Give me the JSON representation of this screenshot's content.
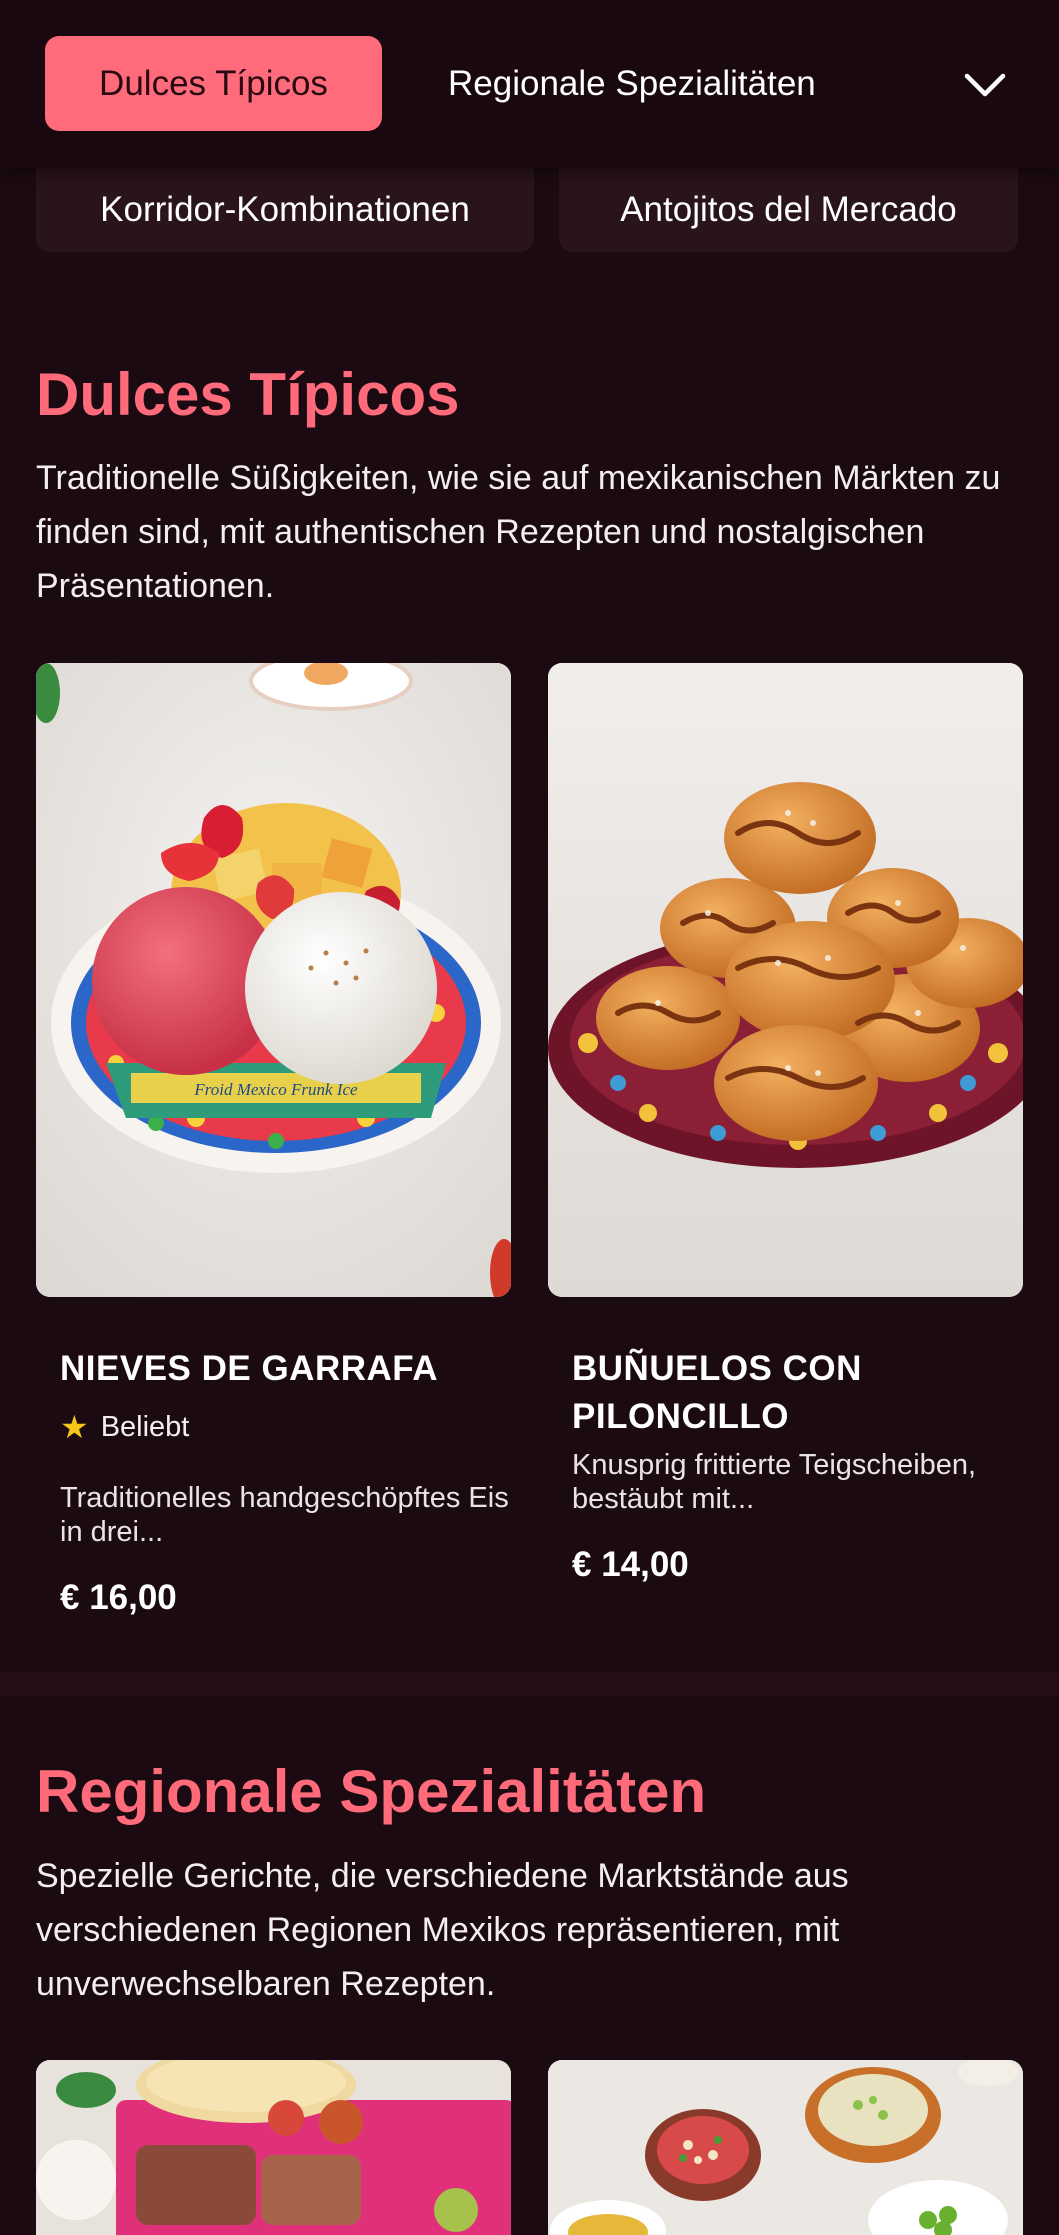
{
  "nav": {
    "active_tab": "Dulces Típicos",
    "tab_2": "Regionale Spezialitäten",
    "secondary": [
      "Korridor-Kombinationen",
      "Antojitos del Mercado"
    ]
  },
  "sections": [
    {
      "title": "Dulces Típicos",
      "description": "Traditionelle Süßigkeiten, wie sie auf mexikanischen Märkten zu finden sind, mit authentischen Rezepten und nostalgischen Präsentationen.",
      "items": [
        {
          "name": "NIEVES DE GARRAFA",
          "badge": "Beliebt",
          "description": "Traditionelles handgeschöpftes Eis in drei...",
          "price": "€ 16,00",
          "image_label": "Froid Mexico Frunk Ice"
        },
        {
          "name": "BUÑUELOS CON PILONCILLO",
          "description": "Knusprig frittierte Teigscheiben, bestäubt mit...",
          "price": "€ 14,00"
        }
      ]
    },
    {
      "title": "Regionale Spezialitäten",
      "description": "Spezielle Gerichte, die verschiedene Marktstände aus verschiedenen Regionen Mexikos repräsentieren, mit unverwechselbaren Rezepten."
    }
  ],
  "colors": {
    "background": "#1c0a12",
    "accent": "#ff6b7a",
    "star": "#f5c518"
  },
  "icons": {
    "chevron": "chevron-down-icon",
    "star": "star-icon"
  }
}
